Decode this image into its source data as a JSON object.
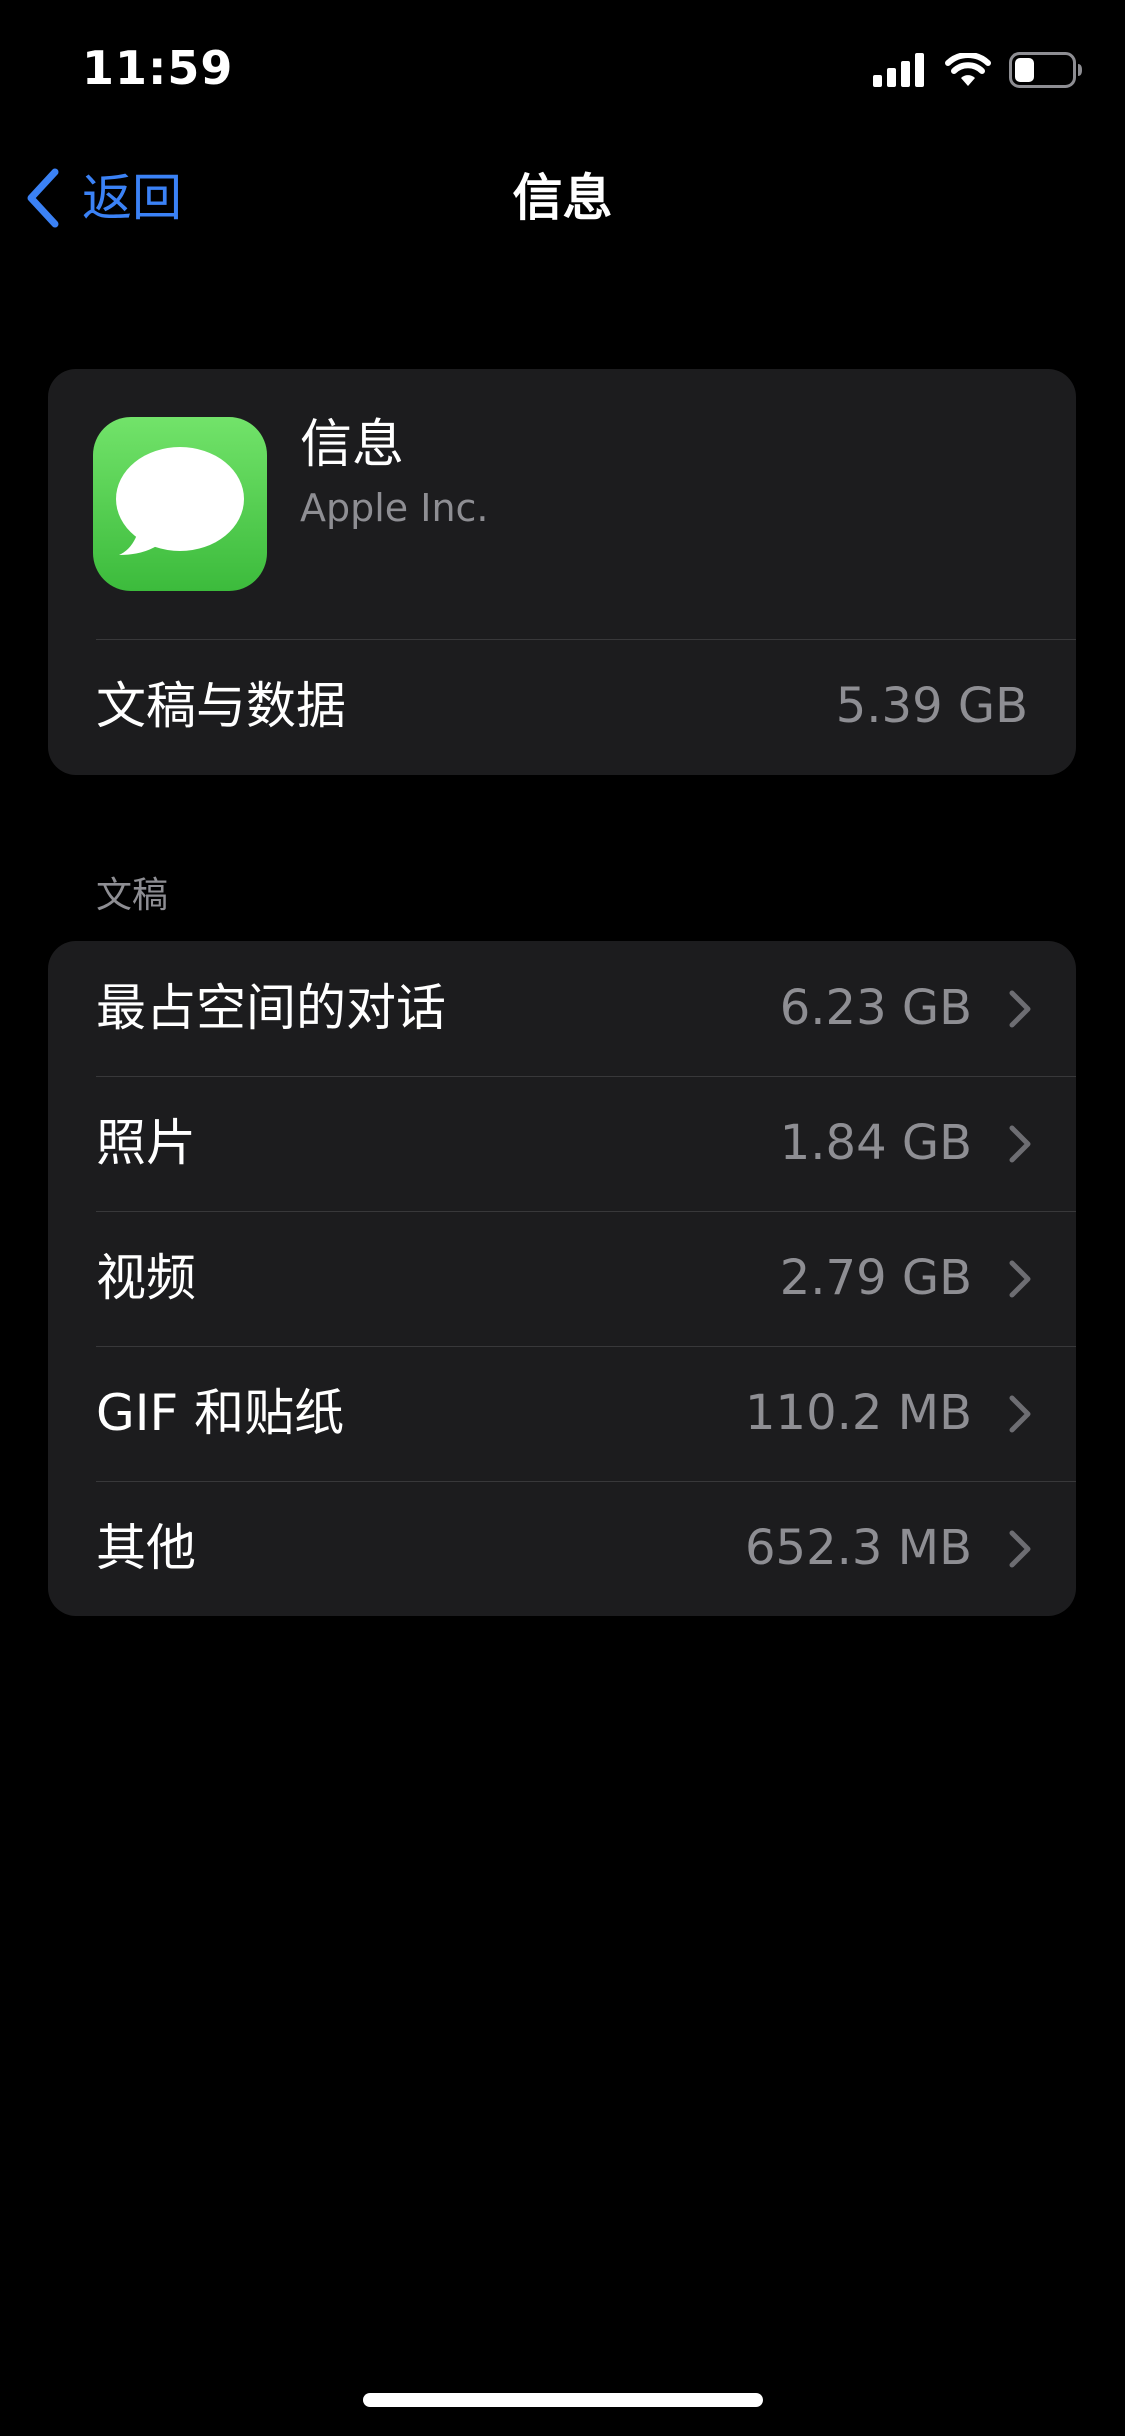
{
  "status_bar": {
    "time": "11:59",
    "icons": [
      "cellular-signal-icon",
      "wifi-icon",
      "battery-icon"
    ],
    "battery_level": 0.35
  },
  "nav": {
    "back_label": "返回",
    "back_icon": "chevron-left-icon",
    "title": "信息"
  },
  "app": {
    "name": "信息",
    "developer": "Apple Inc.",
    "icon": "messages-app-icon",
    "icon_color": "#4cd04a",
    "docs_data_label": "文稿与数据",
    "docs_data_value": "5.39 GB"
  },
  "documents": {
    "header": "文稿",
    "items": [
      {
        "label": "最占空间的对话",
        "value": "6.23 GB"
      },
      {
        "label": "照片",
        "value": "1.84 GB"
      },
      {
        "label": "视频",
        "value": "2.79 GB"
      },
      {
        "label": "GIF 和贴纸",
        "value": "110.2 MB"
      },
      {
        "label": "其他",
        "value": "652.3 MB"
      }
    ]
  },
  "colors": {
    "background": "#000000",
    "card": "#1c1c1e",
    "accent": "#3b82f6",
    "secondary_text": "#8e8e93",
    "separator": "#38383a"
  }
}
